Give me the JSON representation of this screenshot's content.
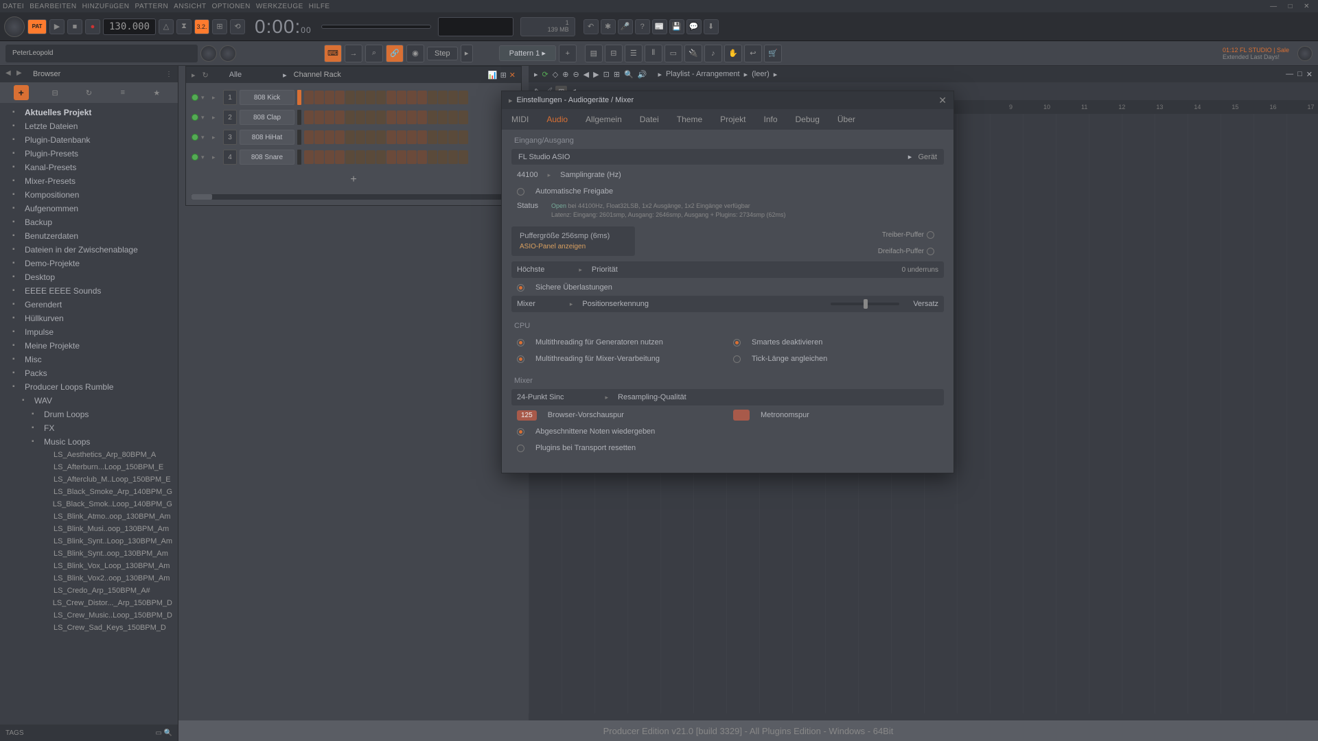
{
  "menu": {
    "items": [
      "DATEI",
      "BEARBEITEN",
      "HINZUFüGEN",
      "PATTERN",
      "ANSICHT",
      "OPTIONEN",
      "WERKZEUGE",
      "HILFE"
    ]
  },
  "transport": {
    "tempo": "130.000",
    "time_main": "0:00:",
    "time_sub": "00",
    "pat_label": "PAT",
    "cpu": "1",
    "mem": "139 MB"
  },
  "toolbar2": {
    "hint": "PeterLeopold",
    "step": "Step",
    "pattern": "Pattern 1"
  },
  "promo": {
    "line1": "01:12  FL STUDIO | Sale",
    "line2": "Extended Last Days!"
  },
  "browser": {
    "title": "Browser",
    "filter": "Alle",
    "folders": [
      {
        "label": "Aktuelles Projekt",
        "bold": true,
        "ind": 0
      },
      {
        "label": "Letzte Dateien",
        "ind": 0
      },
      {
        "label": "Plugin-Datenbank",
        "ind": 0
      },
      {
        "label": "Plugin-Presets",
        "ind": 0
      },
      {
        "label": "Kanal-Presets",
        "ind": 0
      },
      {
        "label": "Mixer-Presets",
        "ind": 0
      },
      {
        "label": "Kompositionen",
        "ind": 0
      },
      {
        "label": "Aufgenommen",
        "ind": 0
      },
      {
        "label": "Backup",
        "ind": 0
      },
      {
        "label": "Benutzerdaten",
        "ind": 0
      },
      {
        "label": "Dateien in der Zwischenablage",
        "ind": 0
      },
      {
        "label": "Demo-Projekte",
        "ind": 0
      },
      {
        "label": "Desktop",
        "ind": 0
      },
      {
        "label": "EEEE EEEE Sounds",
        "ind": 0
      },
      {
        "label": "Gerendert",
        "ind": 0
      },
      {
        "label": "Hüllkurven",
        "ind": 0
      },
      {
        "label": "Impulse",
        "ind": 0
      },
      {
        "label": "Meine Projekte",
        "ind": 0
      },
      {
        "label": "Misc",
        "ind": 0
      },
      {
        "label": "Packs",
        "ind": 0
      },
      {
        "label": "Producer Loops Rumble",
        "ind": 0
      },
      {
        "label": "WAV",
        "ind": 1
      },
      {
        "label": "Drum Loops",
        "ind": 2
      },
      {
        "label": "FX",
        "ind": 2
      },
      {
        "label": "Music Loops",
        "ind": 2
      },
      {
        "label": "LS_Aesthetics_Arp_80BPM_A",
        "ind": 3
      },
      {
        "label": "LS_Afterburn...Loop_150BPM_E",
        "ind": 3
      },
      {
        "label": "LS_Afterclub_M..Loop_150BPM_E",
        "ind": 3
      },
      {
        "label": "LS_Black_Smoke_Arp_140BPM_G",
        "ind": 3
      },
      {
        "label": "LS_Black_Smok..Loop_140BPM_G",
        "ind": 3
      },
      {
        "label": "LS_Blink_Atmo..oop_130BPM_Am",
        "ind": 3
      },
      {
        "label": "LS_Blink_Musi..oop_130BPM_Am",
        "ind": 3
      },
      {
        "label": "LS_Blink_Synt..Loop_130BPM_Am",
        "ind": 3
      },
      {
        "label": "LS_Blink_Synt..oop_130BPM_Am",
        "ind": 3
      },
      {
        "label": "LS_Blink_Vox_Loop_130BPM_Am",
        "ind": 3
      },
      {
        "label": "LS_Blink_Vox2..oop_130BPM_Am",
        "ind": 3
      },
      {
        "label": "LS_Credo_Arp_150BPM_A#",
        "ind": 3
      },
      {
        "label": "LS_Crew_Distor..._Arp_150BPM_D",
        "ind": 3
      },
      {
        "label": "LS_Crew_Music..Loop_150BPM_D",
        "ind": 3
      },
      {
        "label": "LS_Crew_Sad_Keys_150BPM_D",
        "ind": 3
      }
    ],
    "tags": "TAGS"
  },
  "chanrack": {
    "title": "Channel Rack",
    "channels": [
      {
        "num": "1",
        "name": "808 Kick"
      },
      {
        "num": "2",
        "name": "808 Clap"
      },
      {
        "num": "3",
        "name": "808 HiHat"
      },
      {
        "num": "4",
        "name": "808 Snare"
      }
    ],
    "add": "+"
  },
  "playlist": {
    "title": "Playlist - Arrangement",
    "arr": "(leer)",
    "bars": [
      "9",
      "10",
      "11",
      "12",
      "13",
      "14",
      "15",
      "16",
      "17"
    ]
  },
  "settings": {
    "title": "Einstellungen - Audiogeräte / Mixer",
    "tabs": [
      "MIDI",
      "Audio",
      "Allgemein",
      "Datei",
      "Theme",
      "Projekt",
      "Info",
      "Debug",
      "Über"
    ],
    "active_tab": 1,
    "io_group": "Eingang/Ausgang",
    "device": "FL Studio ASIO",
    "device_label": "Gerät",
    "samplerate": "44100",
    "samplerate_label": "Samplingrate (Hz)",
    "autorelease": "Automatische Freigabe",
    "status_label": "Status",
    "status_open": "Open",
    "status_l1": " bei 44100Hz, Float32LSB, 1x2 Ausgänge, 1x2 Eingänge verfügbar",
    "status_l2": "Latenz: Eingang: 2601smp, Ausgang: 2646smp, Ausgang + Plugins: 2734smp (62ms)",
    "buffer": "Puffergröße 256smp (6ms)",
    "asio_panel": "ASIO-Panel anzeigen",
    "driver_buffer": "Treiber-Puffer",
    "triple_buffer": "Dreifach-Puffer",
    "priority": "Höchste",
    "priority_label": "Priorität",
    "underruns": "0 underruns",
    "safe_overload": "Sichere Überlastungen",
    "mixer_pos": "Mixer",
    "pos_label": "Positionserkennung",
    "offset": "Versatz",
    "cpu_group": "CPU",
    "mt_gen": "Multithreading für Generatoren nutzen",
    "mt_mixer": "Multithreading für Mixer-Verarbeitung",
    "smart_disable": "Smartes deaktivieren",
    "tick_align": "Tick-Länge angleichen",
    "mixer_group": "Mixer",
    "resample": "24-Punkt Sinc",
    "resample_label": "Resampling-Qualität",
    "preview_chip": "125",
    "preview": "Browser-Vorschauspur",
    "metro": "Metronomspur",
    "truncated": "Abgeschnittene Noten wiedergeben",
    "reset_plugins": "Plugins bei Transport resetten"
  },
  "footer": "Producer Edition v21.0 [build 3329] - All Plugins Edition - Windows - 64Bit"
}
